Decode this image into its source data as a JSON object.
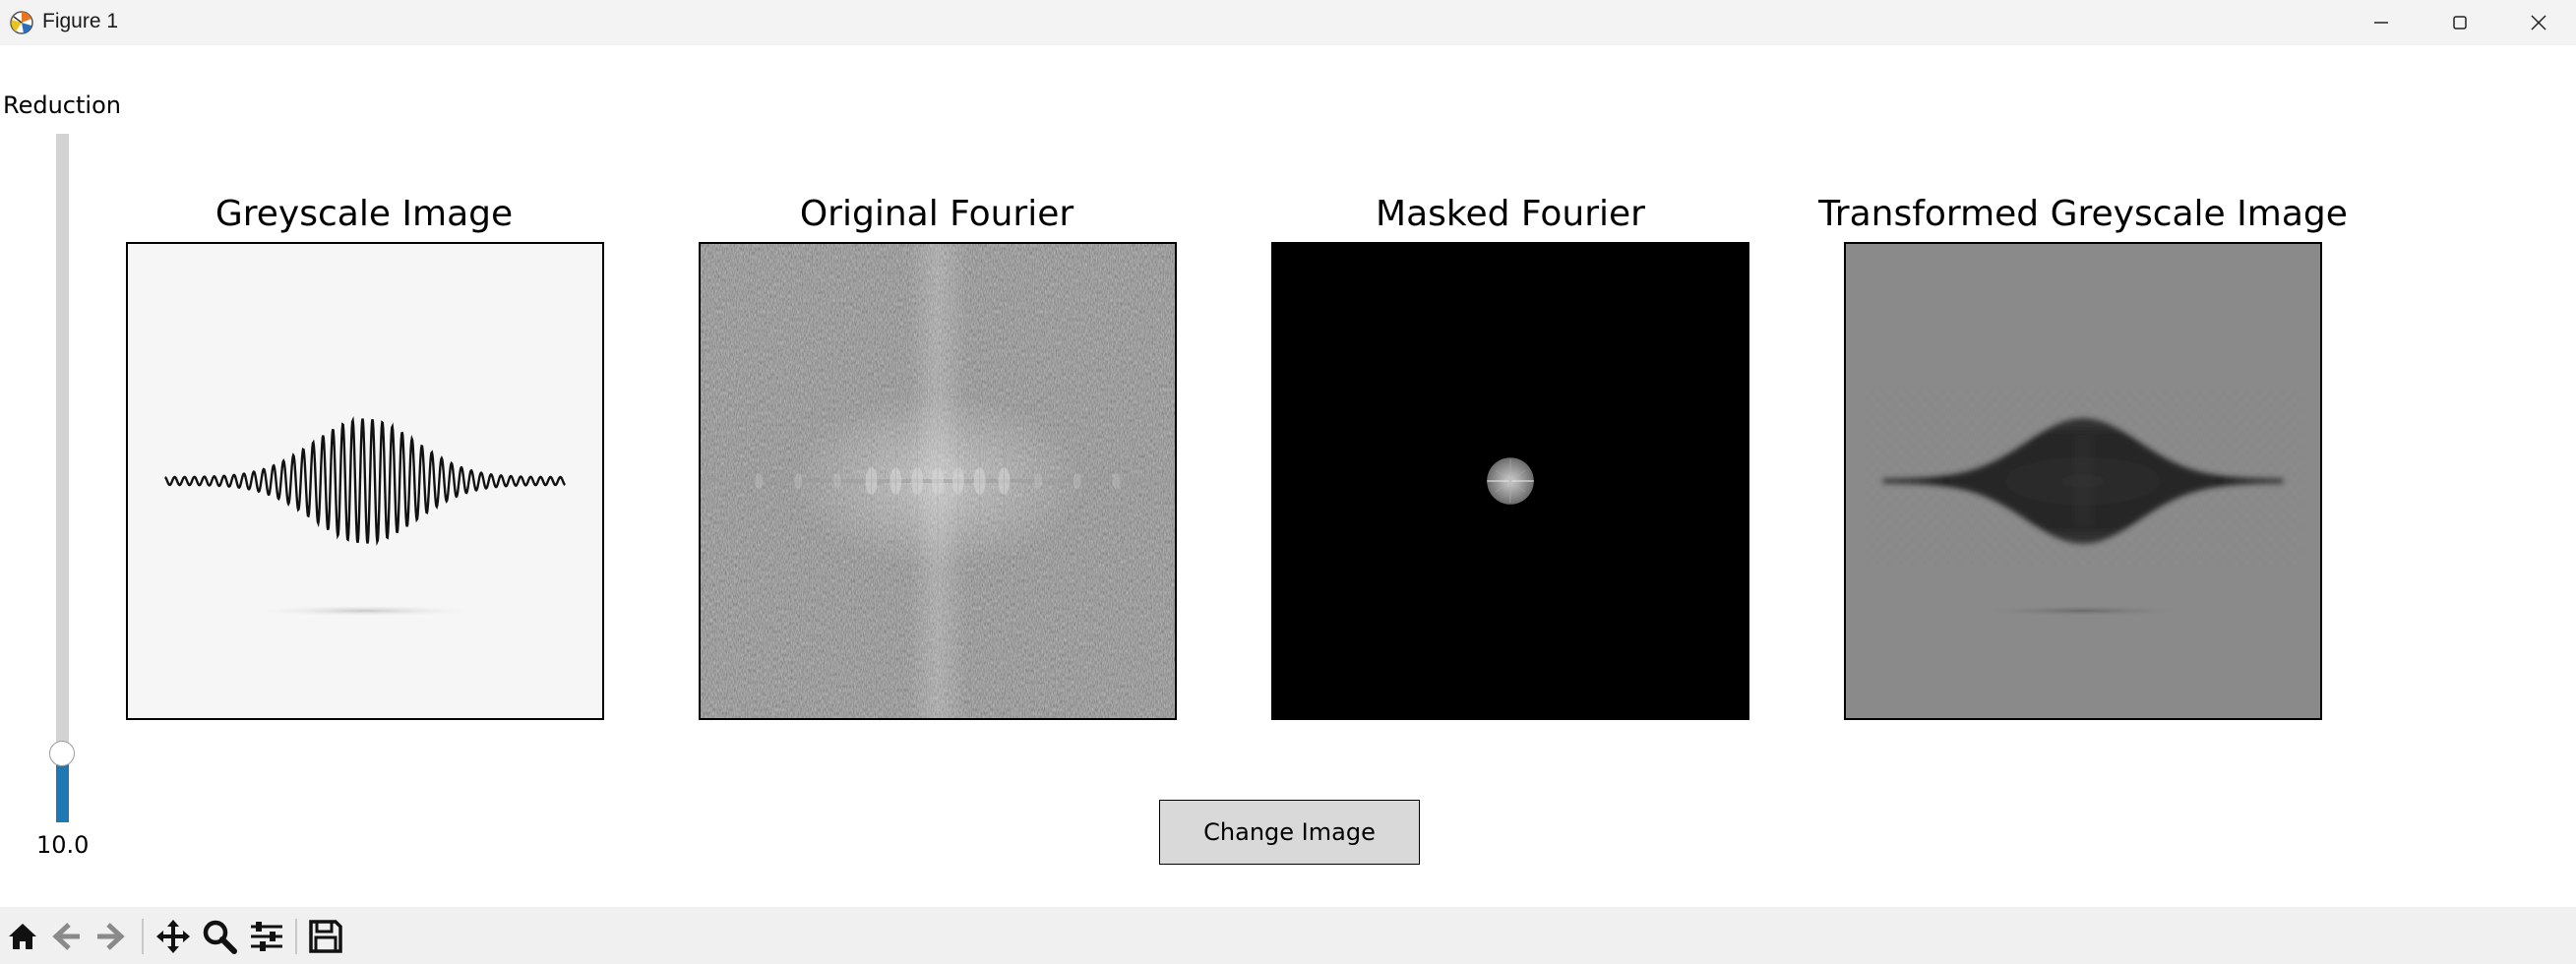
{
  "window": {
    "title": "Figure 1",
    "icons": [
      "matplotlib-icon",
      "minimize-icon",
      "maximize-icon",
      "close-icon"
    ]
  },
  "slider": {
    "label": "Reduction",
    "value_text": "10.0",
    "value": 10.0,
    "fill_fraction": 0.1,
    "colors": {
      "track": "#d3d3d3",
      "fill": "#1f77b4"
    }
  },
  "panels": [
    {
      "title": "Greyscale Image",
      "image": "greyscale-wave-packet"
    },
    {
      "title": "Original Fourier",
      "image": "fourier-magnitude-spectrum"
    },
    {
      "title": "Masked Fourier",
      "image": "masked-fourier-spectrum"
    },
    {
      "title": "Transformed Greyscale Image",
      "image": "low-pass-reconstruction"
    }
  ],
  "button": {
    "label": "Change Image"
  },
  "toolbar": {
    "buttons": [
      "home-icon",
      "back-icon",
      "forward-icon",
      "pan-icon",
      "zoom-icon",
      "configure-subplots-icon",
      "save-icon"
    ]
  }
}
